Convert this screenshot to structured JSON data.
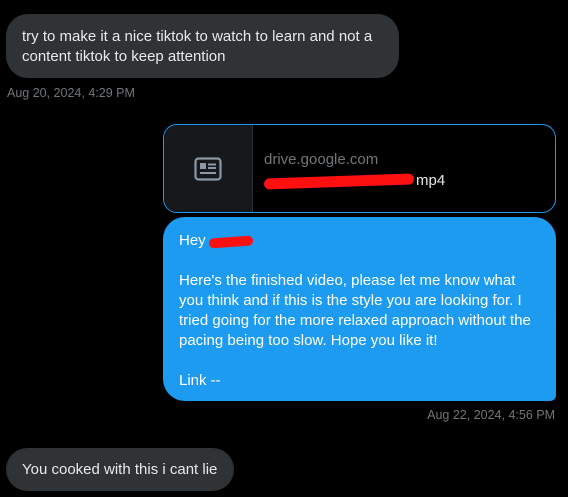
{
  "messages": [
    {
      "direction": "received",
      "text": "try to make it a nice tiktok to watch to learn and not a content tiktok to keep attention",
      "timestamp": "Aug 20, 2024, 4:29 PM"
    },
    {
      "direction": "sent",
      "link_card": {
        "icon": "article-icon",
        "domain": "drive.google.com",
        "file_name_visible": "mp4",
        "file_name_redacted": true
      },
      "greeting": "Hey",
      "greeting_name_redacted": true,
      "body": "Here's the finished video, please let me know what you think and if this is the style you are looking for. I tried going for the more relaxed approach without the pacing being too slow. Hope you like it!",
      "signoff": "Link --",
      "timestamp": "Aug 22, 2024, 4:56 PM"
    },
    {
      "direction": "received",
      "text": "You cooked with this i cant lie"
    }
  ],
  "colors": {
    "background": "#000000",
    "received_bubble": "#2f3336",
    "sent_bubble": "#1d9bf0",
    "timestamp": "#71767b",
    "redaction": "#ff1010"
  }
}
